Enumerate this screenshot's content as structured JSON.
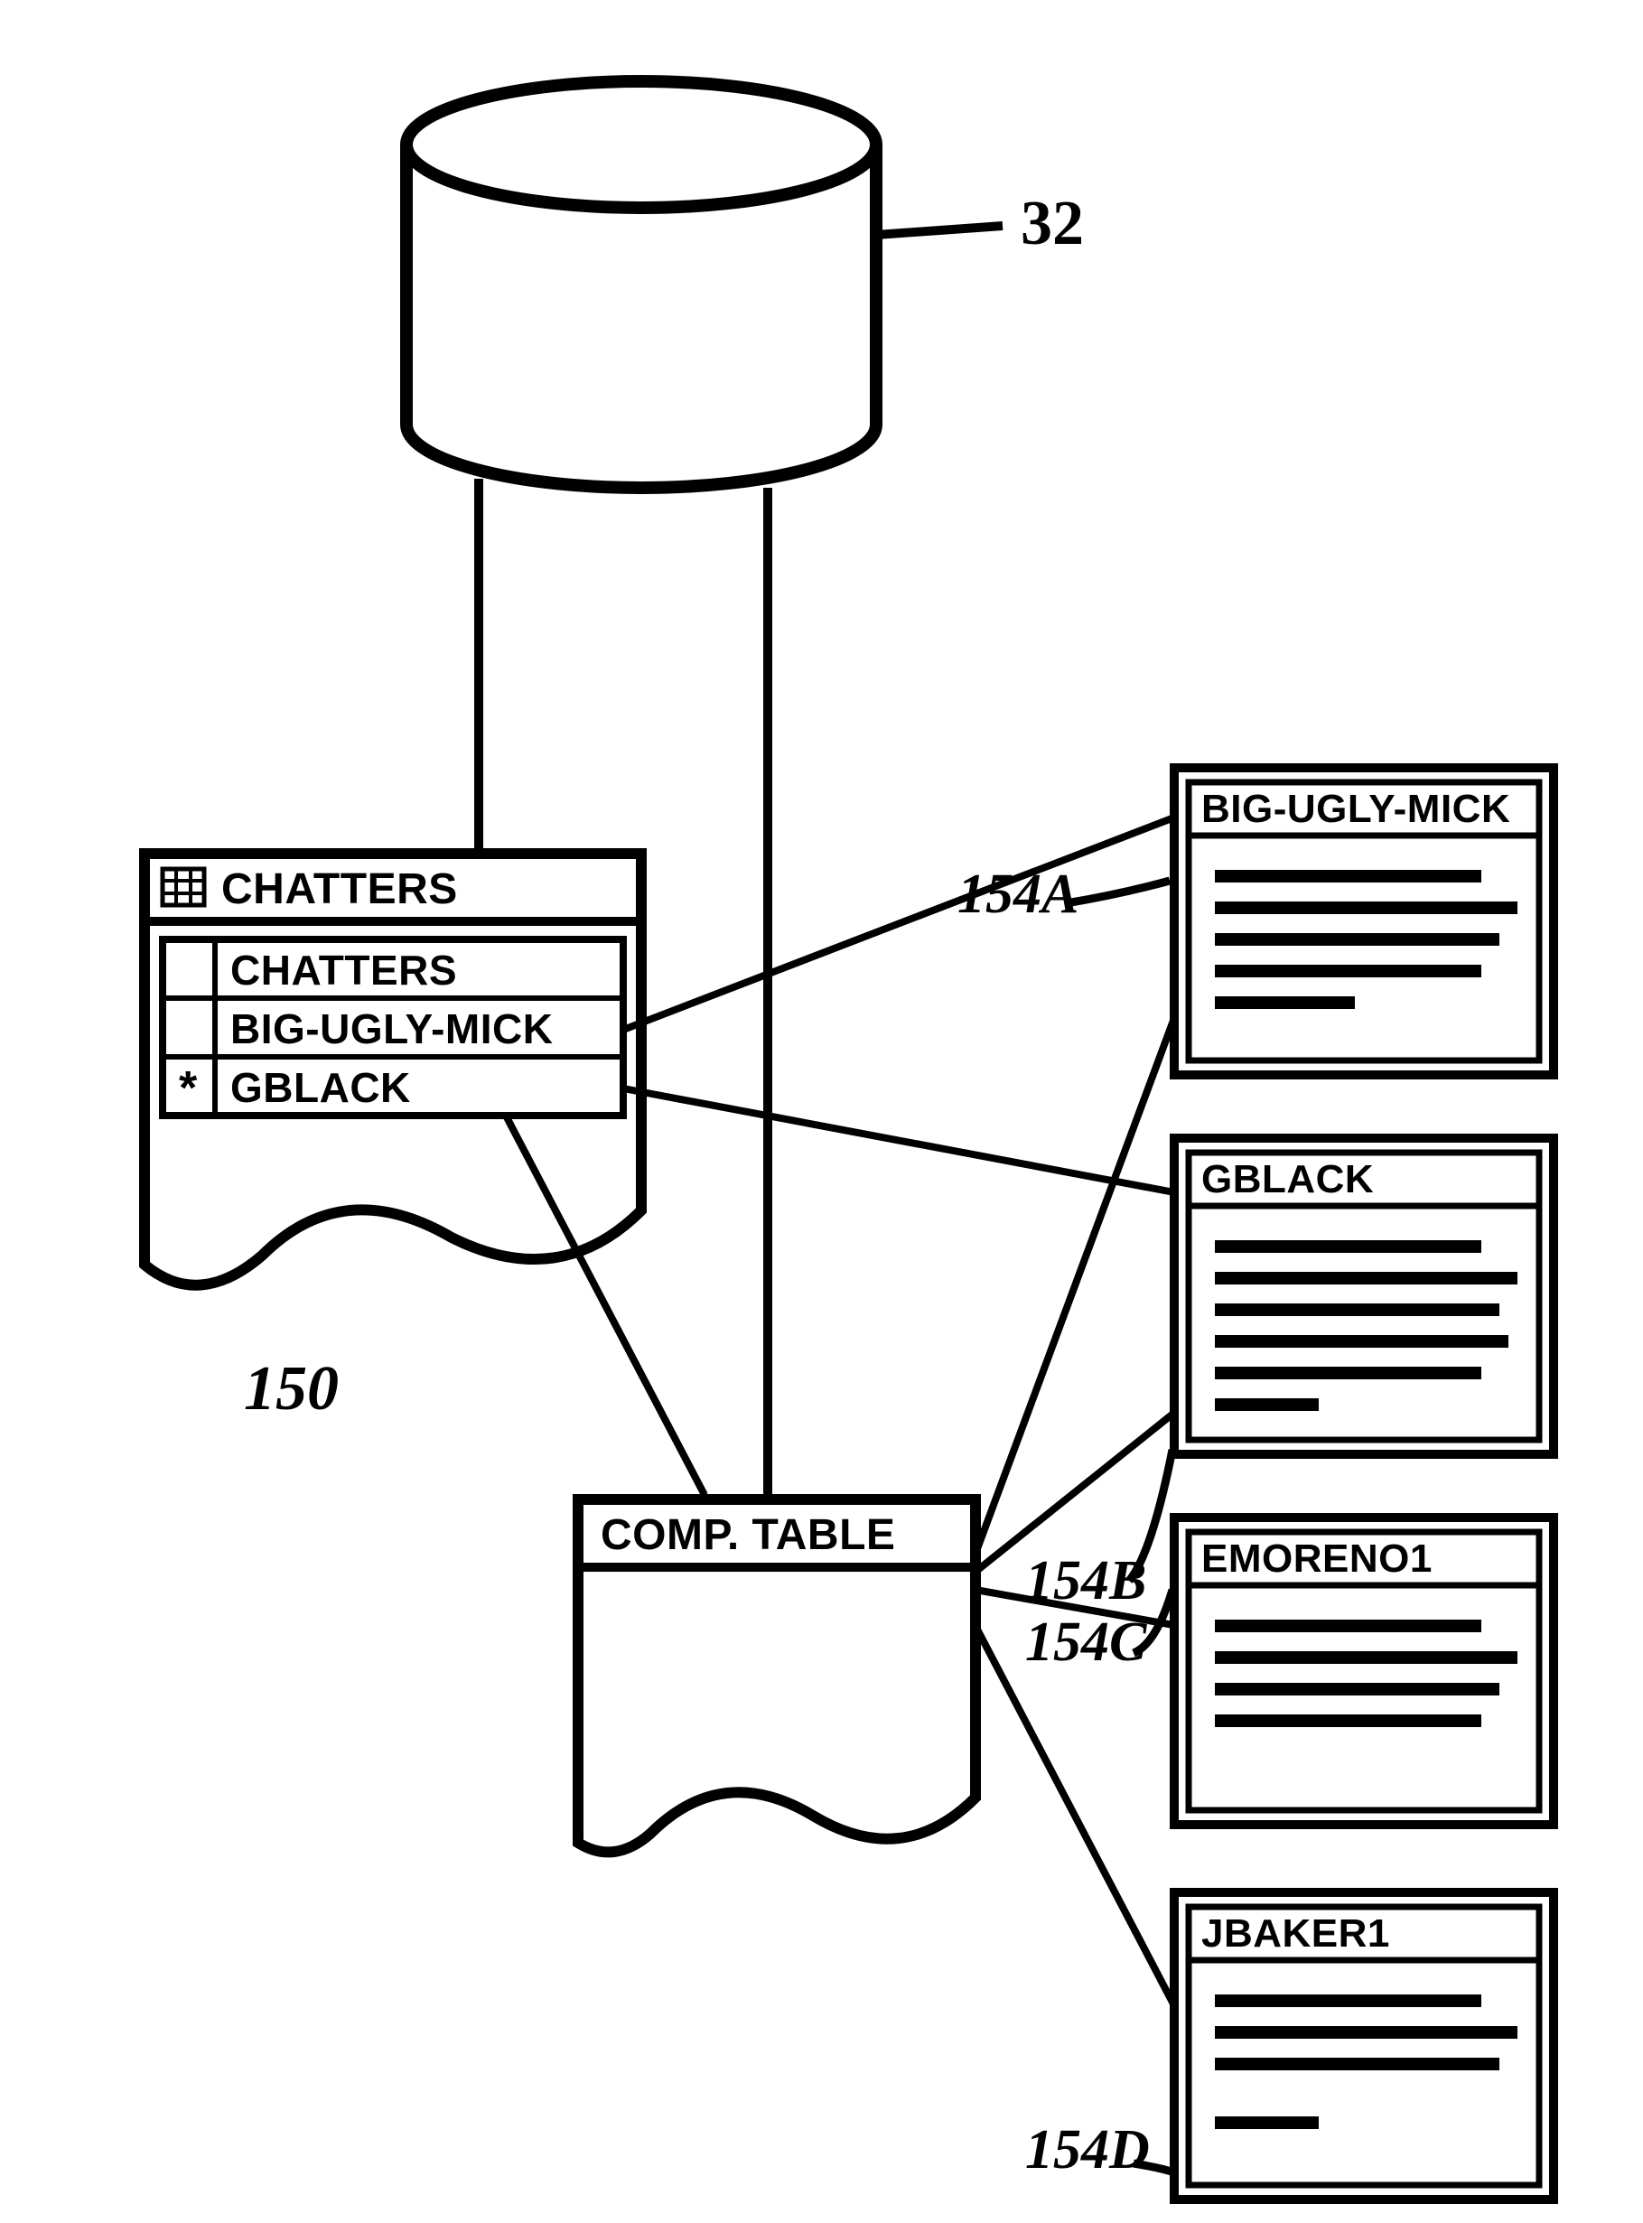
{
  "refs": {
    "cylinder": "32",
    "chatters_table": "150",
    "profileA": "154A",
    "profileB": "154B",
    "profileC": "154C",
    "profileD": "154D"
  },
  "chatters_window": {
    "title": "CHATTERS",
    "rows": [
      {
        "marker": "",
        "name": "CHATTERS"
      },
      {
        "marker": "",
        "name": "BIG-UGLY-MICK"
      },
      {
        "marker": "*",
        "name": "GBLACK"
      }
    ]
  },
  "comp_table": {
    "title": "COMP. TABLE"
  },
  "profiles": [
    {
      "title": "BIG-UGLY-MICK"
    },
    {
      "title": "GBLACK"
    },
    {
      "title": "EMORENO1"
    },
    {
      "title": "JBAKER1"
    }
  ]
}
